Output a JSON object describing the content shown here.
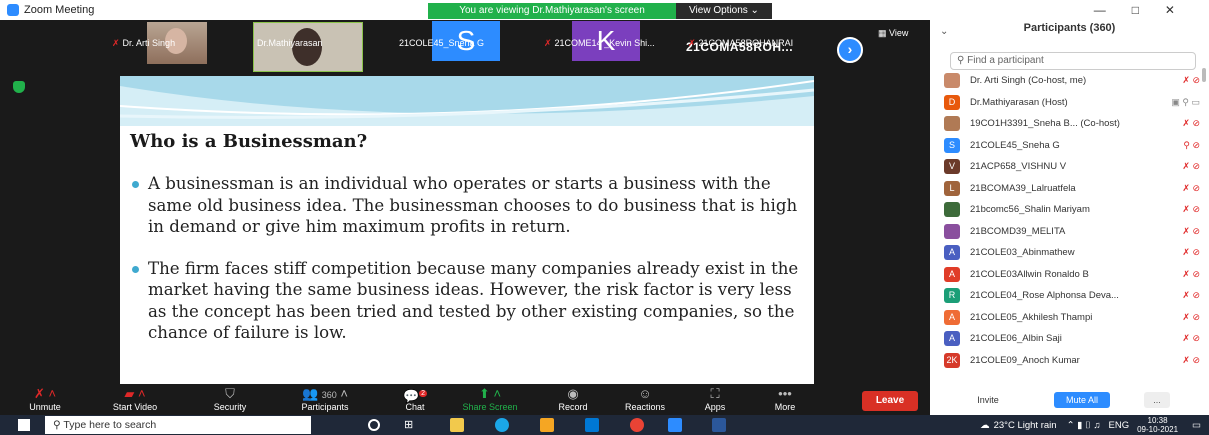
{
  "titlebar": {
    "title": "Zoom Meeting"
  },
  "share_banner": "You are viewing Dr.Mathiyarasan's screen",
  "view_options": "View Options ⌄",
  "thumbnails": {
    "t1": "Dr. Arti Singh",
    "t2": "Dr.Mathiyarasan",
    "t3": "21COLE45_Sneha G",
    "t3_initial": "S",
    "t4": "21COME14 _Kevin Shi...",
    "t4_initial": "K",
    "t5": "21COMA58ROHANRAI",
    "t5_big": "21COMA58ROH...",
    "view_label": "View"
  },
  "slide": {
    "title": "Who is a Businessman?",
    "bullets": [
      "A businessman is an individual who operates or starts a business with the same old business idea. The businessman chooses to do business that is high in demand or give him maximum profits in return.",
      "The firm faces stiff competition because many companies already exist in the market having the same business ideas. However, the risk factor is very less as the concept has been tried and tested by other existing companies, so the chance of failure is low."
    ]
  },
  "toolbar": {
    "unmute": "Unmute",
    "start_video": "Start Video",
    "security": "Security",
    "participants": "Participants",
    "participants_count": "360",
    "chat": "Chat",
    "chat_badge": "2",
    "share_screen": "Share Screen",
    "record": "Record",
    "reactions": "Reactions",
    "apps": "Apps",
    "more": "More",
    "leave": "Leave"
  },
  "panel": {
    "title": "Participants (360)",
    "search_placeholder": "Find a participant",
    "participants": [
      {
        "name": "Dr. Arti Singh (Co-host, me)",
        "initial": "",
        "color": "#c98a6a"
      },
      {
        "name": "Dr.Mathiyarasan (Host)",
        "initial": "D",
        "color": "#e8590c"
      },
      {
        "name": "19CO1H3391_Sneha B... (Co-host)",
        "initial": "",
        "color": "#b07a55"
      },
      {
        "name": "21COLE45_Sneha G",
        "initial": "S",
        "color": "#2d8cff"
      },
      {
        "name": "21ACP658_VISHNU V",
        "initial": "V",
        "color": "#6b3a2a"
      },
      {
        "name": "21BCOMA39_Lalruatfela",
        "initial": "L",
        "color": "#a0643c"
      },
      {
        "name": "21bcomc56_Shalin Mariyam",
        "initial": "",
        "color": "#3d6b3a"
      },
      {
        "name": "21BCOMD39_MELITA",
        "initial": "",
        "color": "#8a4f9e"
      },
      {
        "name": "21COLE03_Abinmathew",
        "initial": "A",
        "color": "#4a5fc1"
      },
      {
        "name": "21COLE03Allwin Ronaldo B",
        "initial": "A",
        "color": "#e03c28"
      },
      {
        "name": "21COLE04_Rose Alphonsa Deva...",
        "initial": "R",
        "color": "#1b9e77"
      },
      {
        "name": "21COLE05_Akhilesh Thampi",
        "initial": "A",
        "color": "#ef6c35"
      },
      {
        "name": "21COLE06_Albin Saji",
        "initial": "A",
        "color": "#4a5fc1"
      },
      {
        "name": "21COLE09_Anoch Kumar",
        "initial": "2K",
        "color": "#d63a2a"
      }
    ],
    "invite": "Invite",
    "mute_all": "Mute All",
    "more": "..."
  },
  "taskbar": {
    "search_placeholder": "Type here to search",
    "weather": "23°C  Light rain",
    "lang": "ENG",
    "time": "10:38",
    "date": "09-10-2021"
  }
}
